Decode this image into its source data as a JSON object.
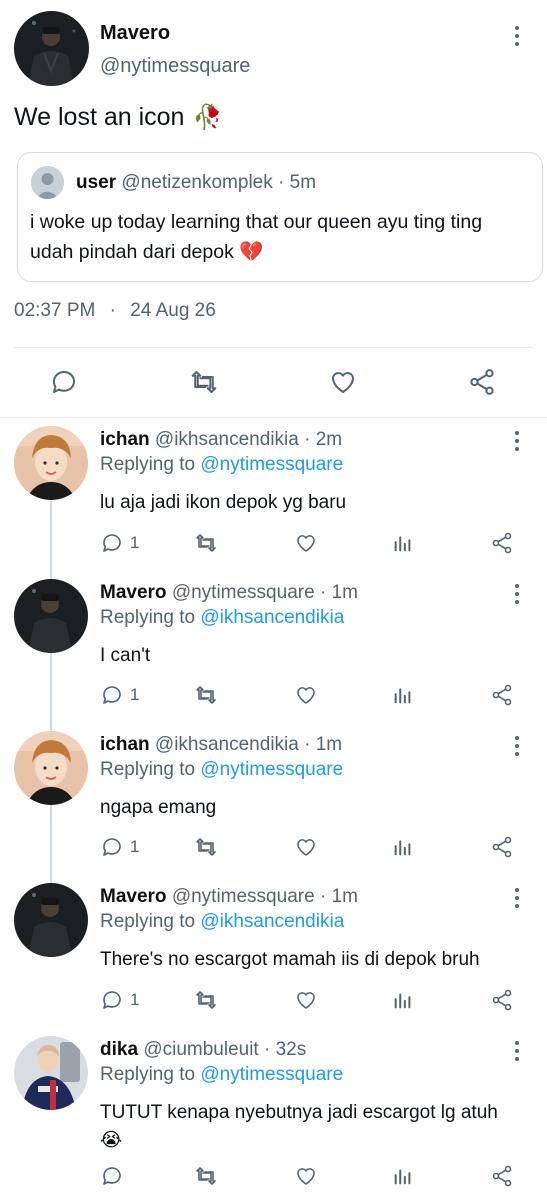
{
  "main_tweet": {
    "name": "Mavero",
    "handle": "@nytimessquare",
    "text": "We lost an icon",
    "emoji": "🥀",
    "quote": {
      "name": "user",
      "handle": "@netizenkomplek",
      "time": "5m",
      "text": "i woke up today learning that our queen ayu ting ting udah pindah dari depok",
      "emoji": "💔"
    },
    "time": "02:37 PM",
    "date": "24 Aug 26"
  },
  "replies": [
    {
      "name": "ichan",
      "handle": "@ikhsancendikia",
      "time": "2m",
      "replying_label": "Replying to",
      "replying_to": "@nytimessquare",
      "text": "lu aja jadi ikon depok yg baru",
      "reply_count": "1"
    },
    {
      "name": "Mavero",
      "handle": "@nytimessquare",
      "time": "1m",
      "replying_label": "Replying to",
      "replying_to": "@ikhsancendikia",
      "text": "I can't",
      "reply_count": "1"
    },
    {
      "name": "ichan",
      "handle": "@ikhsancendikia",
      "time": "1m",
      "replying_label": "Replying to",
      "replying_to": "@nytimessquare",
      "text": "ngapa emang",
      "reply_count": "1"
    },
    {
      "name": "Mavero",
      "handle": "@nytimessquare",
      "time": "1m",
      "replying_label": "Replying to",
      "replying_to": "@ikhsancendikia",
      "text": "There's no escargot mamah iis di depok bruh",
      "reply_count": "1"
    },
    {
      "name": "dika",
      "handle": "@ciumbuleuit",
      "time": "32s",
      "replying_label": "Replying to",
      "replying_to": "@nytimessquare",
      "text": "TUTUT kenapa nyebutnya jadi escargot lg atuh",
      "emoji": "😭",
      "reply_count": ""
    }
  ],
  "colors": {
    "text": "#0f1419",
    "secondary": "#536471",
    "link": "#1d9bf0",
    "divider": "#e6ecf0"
  }
}
